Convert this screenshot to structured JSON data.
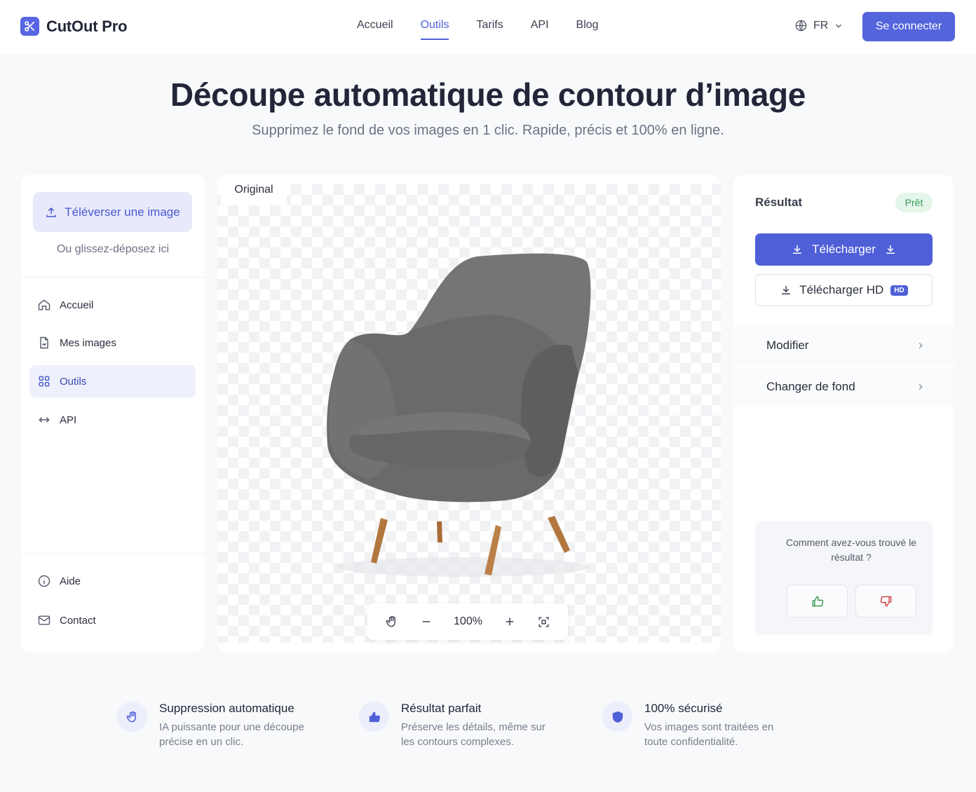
{
  "brand": {
    "name": "CutOut Pro",
    "accent": "#5464dc"
  },
  "nav": {
    "items": [
      {
        "label": "Accueil"
      },
      {
        "label": "Outils",
        "active": true
      },
      {
        "label": "Tarifs"
      },
      {
        "label": "API"
      },
      {
        "label": "Blog"
      }
    ],
    "language": "FR",
    "login_label": "Se connecter"
  },
  "hero": {
    "title": "Découpe automatique de contour d’image",
    "subtitle": "Supprimez le fond de vos images en 1 clic. Rapide, précis et 100% en ligne."
  },
  "sidebar": {
    "upload_label": "Téléverser une image",
    "drop_hint": "Ou glissez-déposez ici",
    "items": [
      {
        "label": "Accueil",
        "icon": "home-icon"
      },
      {
        "label": "Mes images",
        "icon": "image-file-icon"
      },
      {
        "label": "Outils",
        "icon": "tools-icon",
        "active": true
      },
      {
        "label": "API",
        "icon": "api-icon"
      }
    ],
    "footer_items": [
      {
        "label": "Aide",
        "icon": "info-icon"
      },
      {
        "label": "Contact",
        "icon": "mail-icon"
      }
    ]
  },
  "preview": {
    "tab_label": "Original",
    "zoom": "100%"
  },
  "result": {
    "title": "Résultat",
    "status": "Prêt",
    "download_label": "Télécharger",
    "download_hd_label": "Télécharger HD",
    "hd_badge": "HD",
    "options": [
      {
        "label": "Modifier"
      },
      {
        "label": "Changer de fond"
      }
    ],
    "feedback_question": "Comment avez-vous trouvé le résultat ?"
  },
  "features": [
    {
      "title": "Suppression automatique",
      "desc_line1": "IA puissante pour une découpe",
      "desc_line2": "précise en un clic.",
      "icon": "hand-icon"
    },
    {
      "title": "Résultat parfait",
      "desc_line1": "Préserve les détails, même sur",
      "desc_line2": "les contours complexes.",
      "icon": "thumb-icon"
    },
    {
      "title": "100% sécurisé",
      "desc_line1": "Vos images sont traitées en",
      "desc_line2": "toute confidentialité.",
      "icon": "shield-icon"
    }
  ]
}
